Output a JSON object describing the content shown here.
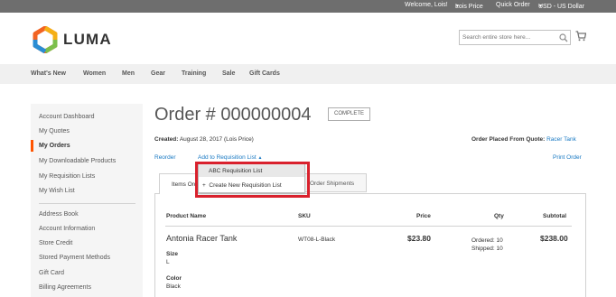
{
  "top_bar": {
    "welcome": "Welcome, Lois!",
    "price_list": "Lois Price",
    "quick_order": "Quick Order",
    "currency": "USD - US Dollar"
  },
  "header": {
    "logo_text": "LUMA",
    "search_placeholder": "Search entire store here...",
    "logo_colors": [
      "#f26322",
      "#f5b016",
      "#7cbf4c",
      "#2a8dd4"
    ]
  },
  "nav": {
    "items": [
      "What's New",
      "Women",
      "Men",
      "Gear",
      "Training",
      "Sale",
      "Gift Cards"
    ]
  },
  "sidebar": {
    "items": [
      {
        "label": "Account Dashboard"
      },
      {
        "label": "My Quotes"
      },
      {
        "label": "My Orders",
        "active": true
      },
      {
        "label": "My Downloadable Products"
      },
      {
        "label": "My Requisition Lists"
      },
      {
        "label": "My Wish List"
      },
      {
        "label": "Address Book"
      },
      {
        "label": "Account Information"
      },
      {
        "label": "Store Credit"
      },
      {
        "label": "Stored Payment Methods"
      },
      {
        "label": "Gift Card"
      },
      {
        "label": "Billing Agreements"
      }
    ]
  },
  "order": {
    "title": "Order # 000000004",
    "status": "COMPLETE",
    "created_label": "Created:",
    "created_value": "August 28, 2017 (Lois Price)",
    "quote_label": "Order Placed From Quote:",
    "quote_link": "Racer Tank",
    "reorder": "Reorder",
    "add_to_requisition": "Add to Requisition List",
    "print_order": "Print Order",
    "requisition_dropdown": {
      "items": [
        "ABC Requisition List",
        "Create New Requisition List"
      ]
    },
    "tabs": {
      "items_ordered": "Items Ordered",
      "order_shipments": "Order Shipments"
    },
    "table": {
      "headers": [
        "Product Name",
        "SKU",
        "Price",
        "Qty",
        "Subtotal"
      ],
      "rows": [
        {
          "name": "Antonia Racer Tank",
          "sku": "WT08-L-Black",
          "price": "$23.80",
          "qty_ordered": "Ordered: 10",
          "qty_shipped": "Shipped: 10",
          "subtotal": "$238.00",
          "options": [
            {
              "label": "Size",
              "value": "L"
            },
            {
              "label": "Color",
              "value": "Black"
            }
          ]
        }
      ]
    }
  }
}
